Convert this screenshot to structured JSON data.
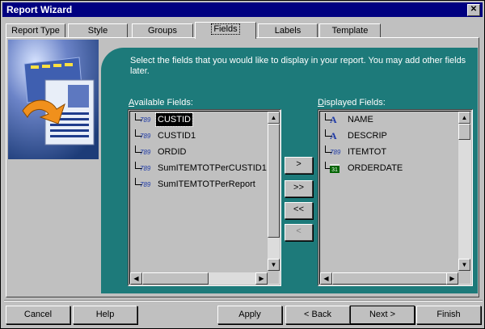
{
  "window": {
    "title": "Report Wizard",
    "close_glyph": "✕"
  },
  "tabs": [
    {
      "label": "Report Type"
    },
    {
      "label": "Style"
    },
    {
      "label": "Groups"
    },
    {
      "label": "Fields",
      "active": true
    },
    {
      "label": "Labels"
    },
    {
      "label": "Template"
    }
  ],
  "instructions": "Select the fields that you would like to display in your report. You may add other fields later.",
  "available": {
    "label_first": "A",
    "label_rest": "vailable Fields:",
    "items": [
      {
        "icon": "number-icon",
        "icon_glyph": "789",
        "name": "CUSTID",
        "selected": true
      },
      {
        "icon": "number-icon",
        "icon_glyph": "789",
        "name": "CUSTID1"
      },
      {
        "icon": "number-icon",
        "icon_glyph": "789",
        "name": "ORDID"
      },
      {
        "icon": "number-icon",
        "icon_glyph": "789",
        "name": "SumITEMTOTPerCUSTID1"
      },
      {
        "icon": "number-icon",
        "icon_glyph": "789",
        "name": "SumITEMTOTPerReport"
      }
    ]
  },
  "displayed": {
    "label_first": "D",
    "label_rest": "isplayed Fields:",
    "items": [
      {
        "icon": "text-icon",
        "icon_glyph": "A",
        "name": "NAME"
      },
      {
        "icon": "text-icon",
        "icon_glyph": "A",
        "name": "DESCRIP"
      },
      {
        "icon": "number-icon",
        "icon_glyph": "789",
        "name": "ITEMTOT"
      },
      {
        "icon": "date-icon",
        "icon_glyph": "31",
        "name": "ORDERDATE"
      }
    ]
  },
  "move_buttons": [
    {
      "label": ">",
      "enabled": true
    },
    {
      "label": ">>",
      "enabled": true
    },
    {
      "label": "<<",
      "enabled": true
    },
    {
      "label": "<",
      "enabled": false
    }
  ],
  "scroll_glyphs": {
    "up": "▲",
    "down": "▼",
    "left": "◀",
    "right": "▶"
  },
  "footer": {
    "cancel": "Cancel",
    "help": "Help",
    "apply": "Apply",
    "back": "< Back",
    "next": "Next >",
    "finish": "Finish"
  },
  "colors": {
    "title_bar": "#000080",
    "panel_accent": "#1d7a7a",
    "selection": "#000000"
  }
}
